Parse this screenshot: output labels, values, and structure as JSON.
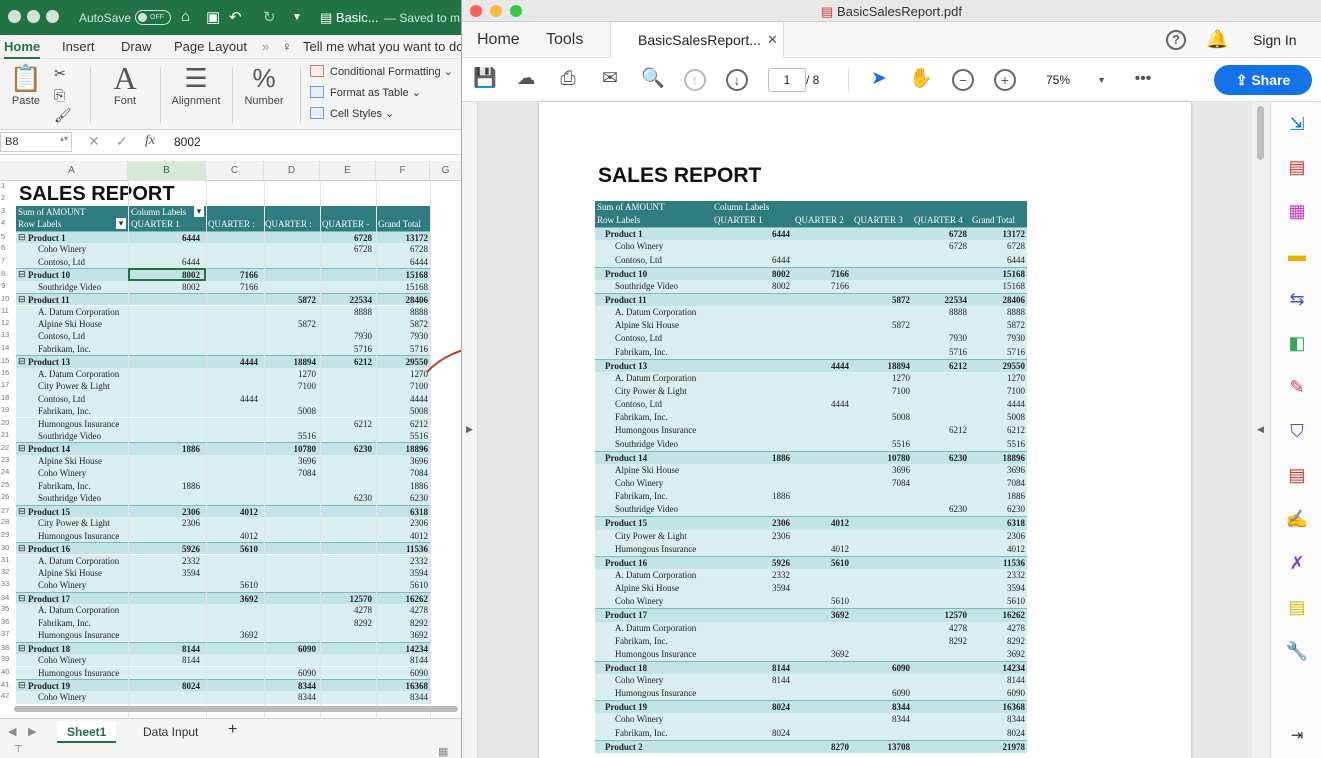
{
  "excel": {
    "autosave": "AutoSave",
    "autosave_toggle": "OFF",
    "doc_name": "Basic...",
    "saved_status": "— Saved to m",
    "tabs": [
      "Home",
      "Insert",
      "Draw",
      "Page Layout"
    ],
    "tell_me": "Tell me what you want to do",
    "ribbon": {
      "paste": "Paste",
      "font": "Font",
      "alignment": "Alignment",
      "number": "Number",
      "conditional_formatting": "Conditional Formatting",
      "format_as_table": "Format as Table",
      "cell_styles": "Cell Styles"
    },
    "name_box": "B8",
    "formula_value": "8002",
    "columns": [
      "A",
      "B",
      "C",
      "D",
      "E",
      "F",
      "G"
    ],
    "sheet_tabs": [
      "Sheet1",
      "Data Input"
    ],
    "add_sheet": "+",
    "report_title": "SALES REPORT",
    "header1": {
      "a": "Sum of AMOUNT",
      "b": "Column Labels"
    },
    "header2": [
      "Row Labels",
      "QUARTER 1",
      "QUARTER :",
      "QUARTER :",
      "QUARTER -",
      "Grand Total"
    ],
    "rows": [
      {
        "n": "5",
        "t": "p",
        "label": "Product 1",
        "q": [
          "6444",
          "",
          "",
          "6728"
        ],
        "g": "13172"
      },
      {
        "n": "6",
        "t": "s",
        "label": "Coho Winery",
        "q": [
          "",
          "",
          "",
          "6728"
        ],
        "g": "6728"
      },
      {
        "n": "7",
        "t": "s",
        "label": "Contoso, Ltd",
        "q": [
          "6444",
          "",
          "",
          ""
        ],
        "g": "6444"
      },
      {
        "n": "8",
        "t": "p",
        "label": "Product 10",
        "q": [
          "8002",
          "7166",
          "",
          ""
        ],
        "g": "15168"
      },
      {
        "n": "9",
        "t": "s",
        "label": "Southridge Video",
        "q": [
          "8002",
          "7166",
          "",
          ""
        ],
        "g": "15168"
      },
      {
        "n": "10",
        "t": "p",
        "label": "Product 11",
        "q": [
          "",
          "",
          "5872",
          "22534"
        ],
        "g": "28406"
      },
      {
        "n": "11",
        "t": "s",
        "label": "A. Datum Corporation",
        "q": [
          "",
          "",
          "",
          "8888"
        ],
        "g": "8888"
      },
      {
        "n": "12",
        "t": "s",
        "label": "Alpine Ski House",
        "q": [
          "",
          "",
          "5872",
          ""
        ],
        "g": "5872"
      },
      {
        "n": "13",
        "t": "s",
        "label": "Contoso, Ltd",
        "q": [
          "",
          "",
          "",
          "7930"
        ],
        "g": "7930"
      },
      {
        "n": "14",
        "t": "s",
        "label": "Fabrikam, Inc.",
        "q": [
          "",
          "",
          "",
          "5716"
        ],
        "g": "5716"
      },
      {
        "n": "15",
        "t": "p",
        "label": "Product 13",
        "q": [
          "",
          "4444",
          "18894",
          "6212"
        ],
        "g": "29550"
      },
      {
        "n": "16",
        "t": "s",
        "label": "A. Datum Corporation",
        "q": [
          "",
          "",
          "1270",
          ""
        ],
        "g": "1270"
      },
      {
        "n": "17",
        "t": "s",
        "label": "City Power & Light",
        "q": [
          "",
          "",
          "7100",
          ""
        ],
        "g": "7100"
      },
      {
        "n": "18",
        "t": "s",
        "label": "Contoso, Ltd",
        "q": [
          "",
          "4444",
          "",
          ""
        ],
        "g": "4444"
      },
      {
        "n": "19",
        "t": "s",
        "label": "Fabrikam, Inc.",
        "q": [
          "",
          "",
          "5008",
          ""
        ],
        "g": "5008"
      },
      {
        "n": "20",
        "t": "s",
        "label": "Humongous Insurance",
        "q": [
          "",
          "",
          "",
          "6212"
        ],
        "g": "6212"
      },
      {
        "n": "21",
        "t": "s",
        "label": "Southridge Video",
        "q": [
          "",
          "",
          "5516",
          ""
        ],
        "g": "5516"
      },
      {
        "n": "22",
        "t": "p",
        "label": "Product 14",
        "q": [
          "1886",
          "",
          "10780",
          "6230"
        ],
        "g": "18896"
      },
      {
        "n": "23",
        "t": "s",
        "label": "Alpine Ski House",
        "q": [
          "",
          "",
          "3696",
          ""
        ],
        "g": "3696"
      },
      {
        "n": "24",
        "t": "s",
        "label": "Coho Winery",
        "q": [
          "",
          "",
          "7084",
          ""
        ],
        "g": "7084"
      },
      {
        "n": "25",
        "t": "s",
        "label": "Fabrikam, Inc.",
        "q": [
          "1886",
          "",
          "",
          ""
        ],
        "g": "1886"
      },
      {
        "n": "26",
        "t": "s",
        "label": "Southridge Video",
        "q": [
          "",
          "",
          "",
          "6230"
        ],
        "g": "6230"
      },
      {
        "n": "27",
        "t": "p",
        "label": "Product 15",
        "q": [
          "2306",
          "4012",
          "",
          ""
        ],
        "g": "6318"
      },
      {
        "n": "28",
        "t": "s",
        "label": "City Power & Light",
        "q": [
          "2306",
          "",
          "",
          ""
        ],
        "g": "2306"
      },
      {
        "n": "29",
        "t": "s",
        "label": "Humongous Insurance",
        "q": [
          "",
          "4012",
          "",
          ""
        ],
        "g": "4012"
      },
      {
        "n": "30",
        "t": "p",
        "label": "Product 16",
        "q": [
          "5926",
          "5610",
          "",
          ""
        ],
        "g": "11536"
      },
      {
        "n": "31",
        "t": "s",
        "label": "A. Datum Corporation",
        "q": [
          "2332",
          "",
          "",
          ""
        ],
        "g": "2332"
      },
      {
        "n": "32",
        "t": "s",
        "label": "Alpine Ski House",
        "q": [
          "3594",
          "",
          "",
          ""
        ],
        "g": "3594"
      },
      {
        "n": "33",
        "t": "s",
        "label": "Coho Winery",
        "q": [
          "",
          "5610",
          "",
          ""
        ],
        "g": "5610"
      },
      {
        "n": "34",
        "t": "p",
        "label": "Product 17",
        "q": [
          "",
          "3692",
          "",
          "12570"
        ],
        "g": "16262"
      },
      {
        "n": "35",
        "t": "s",
        "label": "A. Datum Corporation",
        "q": [
          "",
          "",
          "",
          "4278"
        ],
        "g": "4278"
      },
      {
        "n": "36",
        "t": "s",
        "label": "Fabrikam, Inc.",
        "q": [
          "",
          "",
          "",
          "8292"
        ],
        "g": "8292"
      },
      {
        "n": "37",
        "t": "s",
        "label": "Humongous Insurance",
        "q": [
          "",
          "3692",
          "",
          ""
        ],
        "g": "3692"
      },
      {
        "n": "38",
        "t": "p",
        "label": "Product 18",
        "q": [
          "8144",
          "",
          "6090",
          ""
        ],
        "g": "14234"
      },
      {
        "n": "39",
        "t": "s",
        "label": "Coho Winery",
        "q": [
          "8144",
          "",
          "",
          ""
        ],
        "g": "8144"
      },
      {
        "n": "40",
        "t": "s",
        "label": "Humongous Insurance",
        "q": [
          "",
          "",
          "6090",
          ""
        ],
        "g": "6090"
      },
      {
        "n": "41",
        "t": "p",
        "label": "Product 19",
        "q": [
          "8024",
          "",
          "8344",
          ""
        ],
        "g": "16368"
      },
      {
        "n": "42",
        "t": "s",
        "label": "Coho Winery",
        "q": [
          "",
          "",
          "8344",
          ""
        ],
        "g": "8344"
      }
    ]
  },
  "acrobat": {
    "window_title": "BasicSalesReport.pdf",
    "nav": [
      "Home",
      "Tools"
    ],
    "file_tab": "BasicSalesReport...",
    "sign_in": "Sign In",
    "page_current": "1",
    "page_total": "/ 8",
    "zoom": "75%",
    "share": "Share",
    "report_title": "SALES REPORT",
    "header1": {
      "a": "Sum of AMOUNT",
      "b": "Column Labels"
    },
    "header2": [
      "Row Labels",
      "QUARTER 1",
      "QUARTER 2",
      "QUARTER 3",
      "QUARTER 4",
      "Grand Total"
    ],
    "rows": [
      {
        "t": "p",
        "label": "Product 1",
        "q": [
          "6444",
          "",
          "",
          "6728"
        ],
        "g": "13172"
      },
      {
        "t": "s",
        "label": "Coho Winery",
        "q": [
          "",
          "",
          "",
          "6728"
        ],
        "g": "6728"
      },
      {
        "t": "s",
        "label": "Contoso, Ltd",
        "q": [
          "6444",
          "",
          "",
          ""
        ],
        "g": "6444"
      },
      {
        "t": "p",
        "label": "Product 10",
        "q": [
          "8002",
          "7166",
          "",
          ""
        ],
        "g": "15168"
      },
      {
        "t": "s",
        "label": "Southridge Video",
        "q": [
          "8002",
          "7166",
          "",
          ""
        ],
        "g": "15168"
      },
      {
        "t": "p",
        "label": "Product 11",
        "q": [
          "",
          "",
          "5872",
          "22534"
        ],
        "g": "28406"
      },
      {
        "t": "s",
        "label": "A. Datum Corporation",
        "q": [
          "",
          "",
          "",
          "8888"
        ],
        "g": "8888"
      },
      {
        "t": "s",
        "label": "Alpine Ski House",
        "q": [
          "",
          "",
          "5872",
          ""
        ],
        "g": "5872"
      },
      {
        "t": "s",
        "label": "Contoso, Ltd",
        "q": [
          "",
          "",
          "",
          "7930"
        ],
        "g": "7930"
      },
      {
        "t": "s",
        "label": "Fabrikam, Inc.",
        "q": [
          "",
          "",
          "",
          "5716"
        ],
        "g": "5716"
      },
      {
        "t": "p",
        "label": "Product 13",
        "q": [
          "",
          "4444",
          "18894",
          "6212"
        ],
        "g": "29550"
      },
      {
        "t": "s",
        "label": "A. Datum Corporation",
        "q": [
          "",
          "",
          "1270",
          ""
        ],
        "g": "1270"
      },
      {
        "t": "s",
        "label": "City Power & Light",
        "q": [
          "",
          "",
          "7100",
          ""
        ],
        "g": "7100"
      },
      {
        "t": "s",
        "label": "Contoso, Ltd",
        "q": [
          "",
          "4444",
          "",
          ""
        ],
        "g": "4444"
      },
      {
        "t": "s",
        "label": "Fabrikam, Inc.",
        "q": [
          "",
          "",
          "5008",
          ""
        ],
        "g": "5008"
      },
      {
        "t": "s",
        "label": "Humongous Insurance",
        "q": [
          "",
          "",
          "",
          "6212"
        ],
        "g": "6212"
      },
      {
        "t": "s",
        "label": "Southridge Video",
        "q": [
          "",
          "",
          "5516",
          ""
        ],
        "g": "5516"
      },
      {
        "t": "p",
        "label": "Product 14",
        "q": [
          "1886",
          "",
          "10780",
          "6230"
        ],
        "g": "18896"
      },
      {
        "t": "s",
        "label": "Alpine Ski House",
        "q": [
          "",
          "",
          "3696",
          ""
        ],
        "g": "3696"
      },
      {
        "t": "s",
        "label": "Coho Winery",
        "q": [
          "",
          "",
          "7084",
          ""
        ],
        "g": "7084"
      },
      {
        "t": "s",
        "label": "Fabrikam, Inc.",
        "q": [
          "1886",
          "",
          "",
          ""
        ],
        "g": "1886"
      },
      {
        "t": "s",
        "label": "Southridge Video",
        "q": [
          "",
          "",
          "",
          "6230"
        ],
        "g": "6230"
      },
      {
        "t": "p",
        "label": "Product 15",
        "q": [
          "2306",
          "4012",
          "",
          ""
        ],
        "g": "6318"
      },
      {
        "t": "s",
        "label": "City Power & Light",
        "q": [
          "2306",
          "",
          "",
          ""
        ],
        "g": "2306"
      },
      {
        "t": "s",
        "label": "Humongous Insurance",
        "q": [
          "",
          "4012",
          "",
          ""
        ],
        "g": "4012"
      },
      {
        "t": "p",
        "label": "Product 16",
        "q": [
          "5926",
          "5610",
          "",
          ""
        ],
        "g": "11536"
      },
      {
        "t": "s",
        "label": "A. Datum Corporation",
        "q": [
          "2332",
          "",
          "",
          ""
        ],
        "g": "2332"
      },
      {
        "t": "s",
        "label": "Alpine Ski House",
        "q": [
          "3594",
          "",
          "",
          ""
        ],
        "g": "3594"
      },
      {
        "t": "s",
        "label": "Coho Winery",
        "q": [
          "",
          "5610",
          "",
          ""
        ],
        "g": "5610"
      },
      {
        "t": "p",
        "label": "Product 17",
        "q": [
          "",
          "3692",
          "",
          "12570"
        ],
        "g": "16262"
      },
      {
        "t": "s",
        "label": "A. Datum Corporation",
        "q": [
          "",
          "",
          "",
          "4278"
        ],
        "g": "4278"
      },
      {
        "t": "s",
        "label": "Fabrikam, Inc.",
        "q": [
          "",
          "",
          "",
          "8292"
        ],
        "g": "8292"
      },
      {
        "t": "s",
        "label": "Humongous Insurance",
        "q": [
          "",
          "3692",
          "",
          ""
        ],
        "g": "3692"
      },
      {
        "t": "p",
        "label": "Product 18",
        "q": [
          "8144",
          "",
          "6090",
          ""
        ],
        "g": "14234"
      },
      {
        "t": "s",
        "label": "Coho Winery",
        "q": [
          "8144",
          "",
          "",
          ""
        ],
        "g": "8144"
      },
      {
        "t": "s",
        "label": "Humongous Insurance",
        "q": [
          "",
          "",
          "6090",
          ""
        ],
        "g": "6090"
      },
      {
        "t": "p",
        "label": "Product 19",
        "q": [
          "8024",
          "",
          "8344",
          ""
        ],
        "g": "16368"
      },
      {
        "t": "s",
        "label": "Coho Winery",
        "q": [
          "",
          "",
          "8344",
          ""
        ],
        "g": "8344"
      },
      {
        "t": "s",
        "label": "Fabrikam, Inc.",
        "q": [
          "8024",
          "",
          "",
          ""
        ],
        "g": "8024"
      },
      {
        "t": "p",
        "label": "Product 2",
        "q": [
          "",
          "8270",
          "13708",
          ""
        ],
        "g": "21978"
      }
    ]
  },
  "colors": {
    "excel_green": "#217346",
    "pivot_header": "#2e7b80",
    "pivot_row_light": "#d8eeef",
    "pivot_row_alt": "#c3e4e6",
    "acrobat_blue": "#1473e6",
    "arrow_red": "#c0392b"
  }
}
